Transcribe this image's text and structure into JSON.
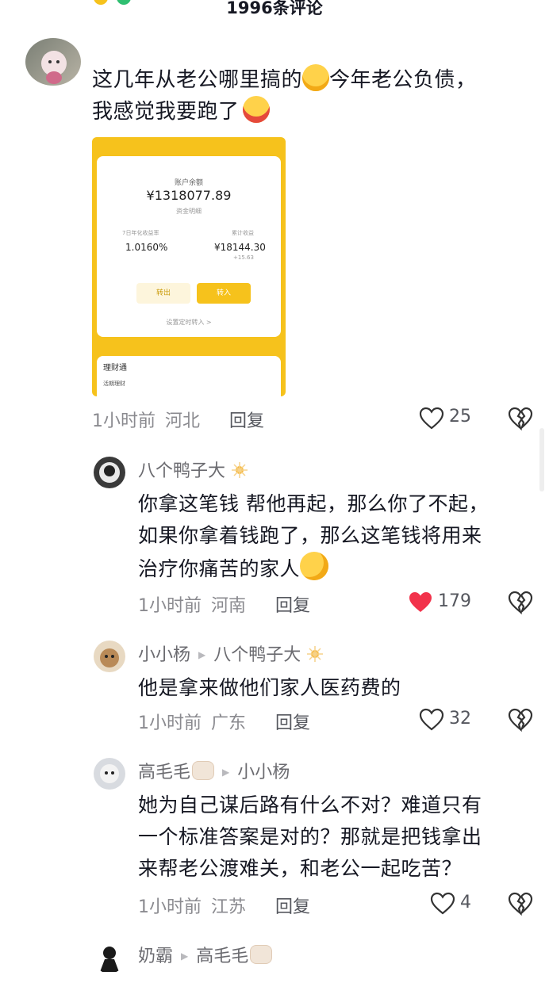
{
  "header": {
    "title": "1996条评论"
  },
  "comments": [
    {
      "username": "",
      "text_line1": "这几年从老公哪里搞的",
      "text_line1b": "今年老公负债，",
      "text_line2": "我感觉我要跑了",
      "time": "1小时前",
      "location": "河北",
      "reply_label": "回复",
      "likes": "25"
    },
    {
      "username": "八个鸭子大",
      "text_line1": "你拿这笔钱 帮他再起，那么你了不起，",
      "text_line2": "如果你拿着钱跑了，那么这笔钱将用来",
      "text_line3": "治疗你痛苦的家人",
      "time": "1小时前",
      "location": "河南",
      "reply_label": "回复",
      "likes": "179",
      "liked": true
    },
    {
      "username": "小小杨",
      "reply_to": "八个鸭子大",
      "text_line1": "他是拿来做他们家人医药费的",
      "time": "1小时前",
      "location": "广东",
      "reply_label": "回复",
      "likes": "32"
    },
    {
      "username": "高毛毛",
      "reply_to": "小小杨",
      "text_line1": "她为自己谋后路有什么不对？难道只有",
      "text_line2": "一个标准答案是对的？那就是把钱拿出",
      "text_line3": "来帮老公渡难关，和老公一起吃苦？",
      "time": "1小时前",
      "location": "江苏",
      "reply_label": "回复",
      "likes": "4"
    },
    {
      "username": "奶霸",
      "reply_to": "高毛毛"
    }
  ],
  "screenshot": {
    "balance_label": "账户余额",
    "balance": "¥1318077.89",
    "detail_link": "资金明细",
    "rate_label": "7日年化收益率",
    "rate": "1.0160%",
    "income_label": "累计收益",
    "income": "¥18144.30",
    "income_sub": "+15.63",
    "btn_out": "转出",
    "btn_in": "转入",
    "auto_link": "设置定时转入 >",
    "product": "理财通",
    "product_sub": "活期理财"
  },
  "colors": {
    "accent_yellow": "#f6c21c",
    "liked_red": "#f2324b"
  }
}
